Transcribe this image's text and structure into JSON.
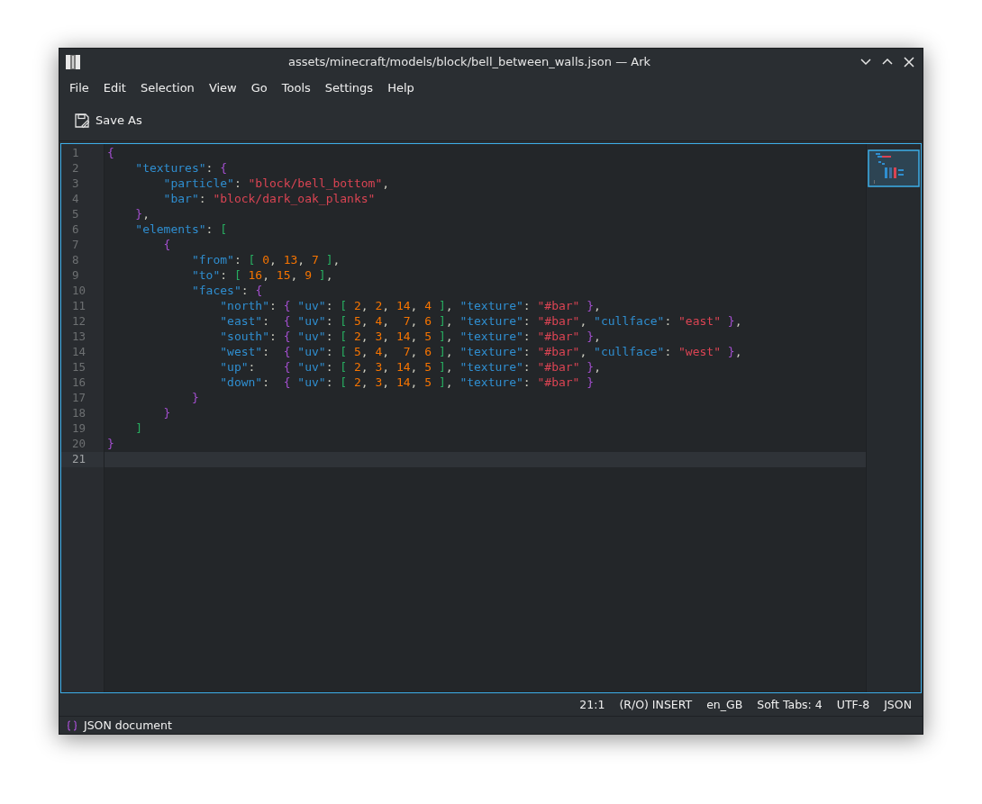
{
  "window": {
    "title": "assets/minecraft/models/block/bell_between_walls.json — Ark"
  },
  "menu": [
    "File",
    "Edit",
    "Selection",
    "View",
    "Go",
    "Tools",
    "Settings",
    "Help"
  ],
  "toolbar": [
    {
      "label": "Save As"
    }
  ],
  "editor": {
    "lines": [
      {
        "number": "1",
        "current": false,
        "tokens": [
          {
            "kind": "brace",
            "text": "{"
          }
        ]
      },
      {
        "number": "2",
        "current": false,
        "tokens": [
          {
            "kind": "key",
            "text": "    \"textures\""
          },
          {
            "kind": "punct",
            "text": ": "
          },
          {
            "kind": "brace",
            "text": "{"
          }
        ]
      },
      {
        "number": "3",
        "current": false,
        "tokens": [
          {
            "kind": "key",
            "text": "        \"particle\""
          },
          {
            "kind": "punct",
            "text": ": "
          },
          {
            "kind": "string",
            "text": "\"block/bell_bottom\""
          },
          {
            "kind": "punct",
            "text": ","
          }
        ]
      },
      {
        "number": "4",
        "current": false,
        "tokens": [
          {
            "kind": "key",
            "text": "        \"bar\""
          },
          {
            "kind": "punct",
            "text": ": "
          },
          {
            "kind": "string",
            "text": "\"block/dark_oak_planks\""
          }
        ]
      },
      {
        "number": "5",
        "current": false,
        "tokens": [
          {
            "kind": "brace",
            "text": "    }"
          },
          {
            "kind": "punct",
            "text": ","
          }
        ]
      },
      {
        "number": "6",
        "current": false,
        "tokens": [
          {
            "kind": "key",
            "text": "    \"elements\""
          },
          {
            "kind": "punct",
            "text": ": "
          },
          {
            "kind": "bracket",
            "text": "["
          }
        ]
      },
      {
        "number": "7",
        "current": false,
        "tokens": [
          {
            "kind": "brace",
            "text": "        {"
          }
        ]
      },
      {
        "number": "8",
        "current": false,
        "tokens": [
          {
            "kind": "key",
            "text": "            \"from\""
          },
          {
            "kind": "punct",
            "text": ": "
          },
          {
            "kind": "bracket",
            "text": "["
          },
          {
            "kind": "number",
            "text": " 0"
          },
          {
            "kind": "punct",
            "text": ", "
          },
          {
            "kind": "number",
            "text": "13"
          },
          {
            "kind": "punct",
            "text": ", "
          },
          {
            "kind": "number",
            "text": "7"
          },
          {
            "kind": "bracket",
            "text": " ]"
          },
          {
            "kind": "punct",
            "text": ","
          }
        ]
      },
      {
        "number": "9",
        "current": false,
        "tokens": [
          {
            "kind": "key",
            "text": "            \"to\""
          },
          {
            "kind": "punct",
            "text": ": "
          },
          {
            "kind": "bracket",
            "text": "["
          },
          {
            "kind": "number",
            "text": " 16"
          },
          {
            "kind": "punct",
            "text": ", "
          },
          {
            "kind": "number",
            "text": "15"
          },
          {
            "kind": "punct",
            "text": ", "
          },
          {
            "kind": "number",
            "text": "9"
          },
          {
            "kind": "bracket",
            "text": " ]"
          },
          {
            "kind": "punct",
            "text": ","
          }
        ]
      },
      {
        "number": "10",
        "current": false,
        "tokens": [
          {
            "kind": "key",
            "text": "            \"faces\""
          },
          {
            "kind": "punct",
            "text": ": "
          },
          {
            "kind": "brace",
            "text": "{"
          }
        ]
      },
      {
        "number": "11",
        "current": false,
        "tokens": [
          {
            "kind": "key",
            "text": "                \"north\""
          },
          {
            "kind": "punct",
            "text": ": "
          },
          {
            "kind": "brace",
            "text": "{"
          },
          {
            "kind": "key",
            "text": " \"uv\""
          },
          {
            "kind": "punct",
            "text": ": "
          },
          {
            "kind": "bracket",
            "text": "["
          },
          {
            "kind": "number",
            "text": " 2"
          },
          {
            "kind": "punct",
            "text": ", "
          },
          {
            "kind": "number",
            "text": "2"
          },
          {
            "kind": "punct",
            "text": ", "
          },
          {
            "kind": "number",
            "text": "14"
          },
          {
            "kind": "punct",
            "text": ", "
          },
          {
            "kind": "number",
            "text": "4"
          },
          {
            "kind": "bracket",
            "text": " ]"
          },
          {
            "kind": "punct",
            "text": ", "
          },
          {
            "kind": "key",
            "text": "\"texture\""
          },
          {
            "kind": "punct",
            "text": ": "
          },
          {
            "kind": "string",
            "text": "\"#bar\""
          },
          {
            "kind": "brace",
            "text": " }"
          },
          {
            "kind": "punct",
            "text": ","
          }
        ]
      },
      {
        "number": "12",
        "current": false,
        "tokens": [
          {
            "kind": "key",
            "text": "                \"east\""
          },
          {
            "kind": "punct",
            "text": ":  "
          },
          {
            "kind": "brace",
            "text": "{"
          },
          {
            "kind": "key",
            "text": " \"uv\""
          },
          {
            "kind": "punct",
            "text": ": "
          },
          {
            "kind": "bracket",
            "text": "["
          },
          {
            "kind": "number",
            "text": " 5"
          },
          {
            "kind": "punct",
            "text": ", "
          },
          {
            "kind": "number",
            "text": "4"
          },
          {
            "kind": "punct",
            "text": ",  "
          },
          {
            "kind": "number",
            "text": "7"
          },
          {
            "kind": "punct",
            "text": ", "
          },
          {
            "kind": "number",
            "text": "6"
          },
          {
            "kind": "bracket",
            "text": " ]"
          },
          {
            "kind": "punct",
            "text": ", "
          },
          {
            "kind": "key",
            "text": "\"texture\""
          },
          {
            "kind": "punct",
            "text": ": "
          },
          {
            "kind": "string",
            "text": "\"#bar\""
          },
          {
            "kind": "punct",
            "text": ", "
          },
          {
            "kind": "key",
            "text": "\"cullface\""
          },
          {
            "kind": "punct",
            "text": ": "
          },
          {
            "kind": "string",
            "text": "\"east\""
          },
          {
            "kind": "brace",
            "text": " }"
          },
          {
            "kind": "punct",
            "text": ","
          }
        ]
      },
      {
        "number": "13",
        "current": false,
        "tokens": [
          {
            "kind": "key",
            "text": "                \"south\""
          },
          {
            "kind": "punct",
            "text": ": "
          },
          {
            "kind": "brace",
            "text": "{"
          },
          {
            "kind": "key",
            "text": " \"uv\""
          },
          {
            "kind": "punct",
            "text": ": "
          },
          {
            "kind": "bracket",
            "text": "["
          },
          {
            "kind": "number",
            "text": " 2"
          },
          {
            "kind": "punct",
            "text": ", "
          },
          {
            "kind": "number",
            "text": "3"
          },
          {
            "kind": "punct",
            "text": ", "
          },
          {
            "kind": "number",
            "text": "14"
          },
          {
            "kind": "punct",
            "text": ", "
          },
          {
            "kind": "number",
            "text": "5"
          },
          {
            "kind": "bracket",
            "text": " ]"
          },
          {
            "kind": "punct",
            "text": ", "
          },
          {
            "kind": "key",
            "text": "\"texture\""
          },
          {
            "kind": "punct",
            "text": ": "
          },
          {
            "kind": "string",
            "text": "\"#bar\""
          },
          {
            "kind": "brace",
            "text": " }"
          },
          {
            "kind": "punct",
            "text": ","
          }
        ]
      },
      {
        "number": "14",
        "current": false,
        "tokens": [
          {
            "kind": "key",
            "text": "                \"west\""
          },
          {
            "kind": "punct",
            "text": ":  "
          },
          {
            "kind": "brace",
            "text": "{"
          },
          {
            "kind": "key",
            "text": " \"uv\""
          },
          {
            "kind": "punct",
            "text": ": "
          },
          {
            "kind": "bracket",
            "text": "["
          },
          {
            "kind": "number",
            "text": " 5"
          },
          {
            "kind": "punct",
            "text": ", "
          },
          {
            "kind": "number",
            "text": "4"
          },
          {
            "kind": "punct",
            "text": ",  "
          },
          {
            "kind": "number",
            "text": "7"
          },
          {
            "kind": "punct",
            "text": ", "
          },
          {
            "kind": "number",
            "text": "6"
          },
          {
            "kind": "bracket",
            "text": " ]"
          },
          {
            "kind": "punct",
            "text": ", "
          },
          {
            "kind": "key",
            "text": "\"texture\""
          },
          {
            "kind": "punct",
            "text": ": "
          },
          {
            "kind": "string",
            "text": "\"#bar\""
          },
          {
            "kind": "punct",
            "text": ", "
          },
          {
            "kind": "key",
            "text": "\"cullface\""
          },
          {
            "kind": "punct",
            "text": ": "
          },
          {
            "kind": "string",
            "text": "\"west\""
          },
          {
            "kind": "brace",
            "text": " }"
          },
          {
            "kind": "punct",
            "text": ","
          }
        ]
      },
      {
        "number": "15",
        "current": false,
        "tokens": [
          {
            "kind": "key",
            "text": "                \"up\""
          },
          {
            "kind": "punct",
            "text": ":    "
          },
          {
            "kind": "brace",
            "text": "{"
          },
          {
            "kind": "key",
            "text": " \"uv\""
          },
          {
            "kind": "punct",
            "text": ": "
          },
          {
            "kind": "bracket",
            "text": "["
          },
          {
            "kind": "number",
            "text": " 2"
          },
          {
            "kind": "punct",
            "text": ", "
          },
          {
            "kind": "number",
            "text": "3"
          },
          {
            "kind": "punct",
            "text": ", "
          },
          {
            "kind": "number",
            "text": "14"
          },
          {
            "kind": "punct",
            "text": ", "
          },
          {
            "kind": "number",
            "text": "5"
          },
          {
            "kind": "bracket",
            "text": " ]"
          },
          {
            "kind": "punct",
            "text": ", "
          },
          {
            "kind": "key",
            "text": "\"texture\""
          },
          {
            "kind": "punct",
            "text": ": "
          },
          {
            "kind": "string",
            "text": "\"#bar\""
          },
          {
            "kind": "brace",
            "text": " }"
          },
          {
            "kind": "punct",
            "text": ","
          }
        ]
      },
      {
        "number": "16",
        "current": false,
        "tokens": [
          {
            "kind": "key",
            "text": "                \"down\""
          },
          {
            "kind": "punct",
            "text": ":  "
          },
          {
            "kind": "brace",
            "text": "{"
          },
          {
            "kind": "key",
            "text": " \"uv\""
          },
          {
            "kind": "punct",
            "text": ": "
          },
          {
            "kind": "bracket",
            "text": "["
          },
          {
            "kind": "number",
            "text": " 2"
          },
          {
            "kind": "punct",
            "text": ", "
          },
          {
            "kind": "number",
            "text": "3"
          },
          {
            "kind": "punct",
            "text": ", "
          },
          {
            "kind": "number",
            "text": "14"
          },
          {
            "kind": "punct",
            "text": ", "
          },
          {
            "kind": "number",
            "text": "5"
          },
          {
            "kind": "bracket",
            "text": " ]"
          },
          {
            "kind": "punct",
            "text": ", "
          },
          {
            "kind": "key",
            "text": "\"texture\""
          },
          {
            "kind": "punct",
            "text": ": "
          },
          {
            "kind": "string",
            "text": "\"#bar\""
          },
          {
            "kind": "brace",
            "text": " }"
          }
        ]
      },
      {
        "number": "17",
        "current": false,
        "tokens": [
          {
            "kind": "brace",
            "text": "            }"
          }
        ]
      },
      {
        "number": "18",
        "current": false,
        "tokens": [
          {
            "kind": "brace",
            "text": "        }"
          }
        ]
      },
      {
        "number": "19",
        "current": false,
        "tokens": [
          {
            "kind": "bracket",
            "text": "    ]"
          }
        ]
      },
      {
        "number": "20",
        "current": false,
        "tokens": [
          {
            "kind": "brace",
            "text": "}"
          }
        ]
      },
      {
        "number": "21",
        "current": true
      }
    ]
  },
  "status_bar": {
    "items": [
      "21:1",
      "(R/O) INSERT",
      "en_GB",
      "Soft Tabs: 4",
      "UTF-8",
      "JSON"
    ]
  },
  "footer": {
    "label": "JSON document"
  }
}
